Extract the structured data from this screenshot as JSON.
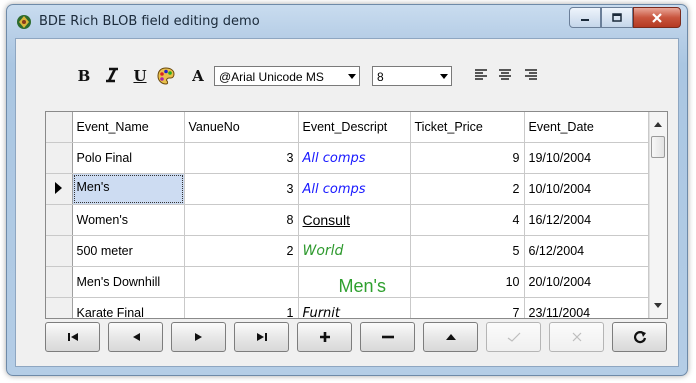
{
  "window": {
    "title": "BDE Rich BLOB field editing demo"
  },
  "toolbar": {
    "bold": "B",
    "italic": "I",
    "underline": "U",
    "font_label": "A",
    "font_name": "@Arial Unicode MS",
    "font_size": "8"
  },
  "grid": {
    "columns": [
      "Event_Name",
      "VanueNo",
      "Event_Descript",
      "Ticket_Price",
      "Event_Date"
    ],
    "rows": [
      {
        "name": "Polo Final",
        "venue": "3",
        "descript": "All comps",
        "price": "9",
        "date": "19/10/2004"
      },
      {
        "name": "Men's",
        "venue": "3",
        "descript": "All comps",
        "price": "2",
        "date": "10/10/2004"
      },
      {
        "name": "Women's",
        "venue": "8",
        "descript": "Consult",
        "price": "4",
        "date": "16/12/2004"
      },
      {
        "name": "500 meter",
        "venue": "2",
        "descript": "World",
        "price": "5",
        "date": "6/12/2004"
      },
      {
        "name": "Men's Downhill",
        "venue": "",
        "descript": "Men's",
        "price": "10",
        "date": "20/10/2004"
      },
      {
        "name": "Karate Final",
        "venue": "1",
        "descript": "Furnit",
        "price": "7",
        "date": "23/11/2004"
      }
    ]
  },
  "colors": {
    "accent_blue": "#1a1aff",
    "accent_green": "#2f9a2f",
    "selection": "#cddcf2",
    "close_red": "#c9553e"
  }
}
